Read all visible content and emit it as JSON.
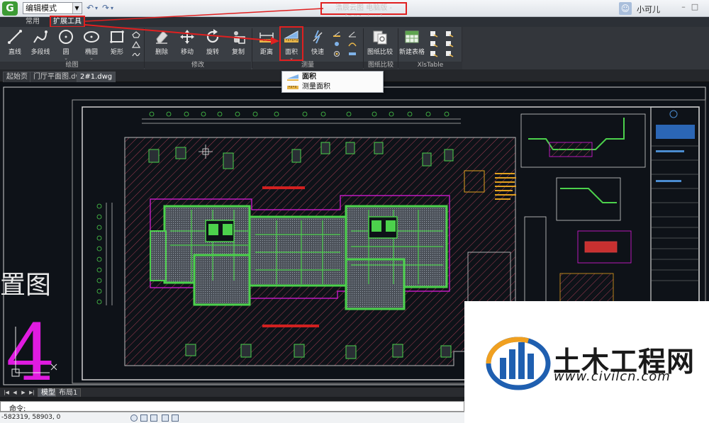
{
  "titlebar": {
    "mode": "编辑模式",
    "title": "浩辰云图 电脑版 - [2#1.dwg]",
    "username": "小可儿",
    "logo": "G",
    "min": "–",
    "max": "□"
  },
  "tabs": {
    "changyong": "常用",
    "kuozhan": "扩展工具"
  },
  "ribbon": {
    "groups": {
      "draw": "绘图",
      "modify": "修改",
      "measure": "测量",
      "compare": "图纸比较",
      "xls": "XlsTable"
    },
    "tools": {
      "line": "直线",
      "polyline": "多段线",
      "circle": "圆",
      "ellipse": "椭圆",
      "rect": "矩形",
      "erase": "删除",
      "move": "移动",
      "rotate": "旋转",
      "copy": "复制",
      "distance": "距离",
      "area": "面积",
      "fast": "快速",
      "compare": "图纸比较",
      "newtable": "新建表格"
    }
  },
  "doctabs": [
    "起始页",
    "门厅平面图.dwg",
    "2#1.dwg"
  ],
  "dropdown": {
    "area": "面积",
    "measure_area": "测量面积"
  },
  "layout": {
    "model": "模型",
    "layout1": "布局1"
  },
  "cmd": {
    "label": "命令:"
  },
  "status": {
    "coords": "-582319, 58903, 0"
  },
  "watermark": {
    "title": "土木工程网",
    "url": "www.civilcn.com"
  },
  "drawing": {
    "big_text": "置图",
    "big_digit": "4"
  },
  "colors": {
    "highlight": "#e02020",
    "canvas": "#0e1218",
    "wall_green": "#4cd14c",
    "magenta": "#e01be0"
  }
}
